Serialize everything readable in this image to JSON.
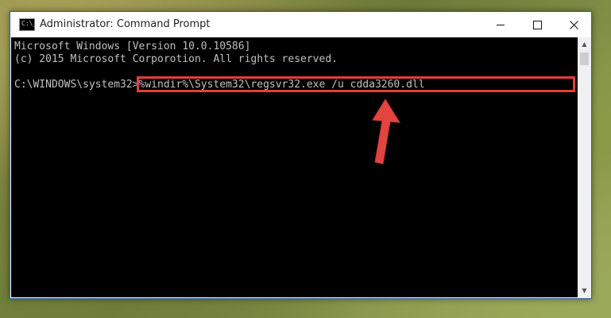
{
  "window": {
    "title": "Administrator: Command Prompt",
    "icon_text": "C:\\_"
  },
  "console": {
    "lines": [
      "Microsoft Windows [Version 10.0.10586]",
      "(c) 2015 Microsoft Corporotion. All rights reserved.",
      "",
      "C:\\WINDOWS\\system32>%windir%\\System32\\regsvr32.exe /u cdda3260.dll"
    ]
  },
  "colors": {
    "highlight": "#e0403a",
    "console_bg": "#000000",
    "console_text": "#c0c0c0"
  },
  "icons": {
    "minimize": "minimize-icon",
    "maximize": "maximize-icon",
    "close": "close-icon",
    "annotation": "red-arrow-icon"
  }
}
